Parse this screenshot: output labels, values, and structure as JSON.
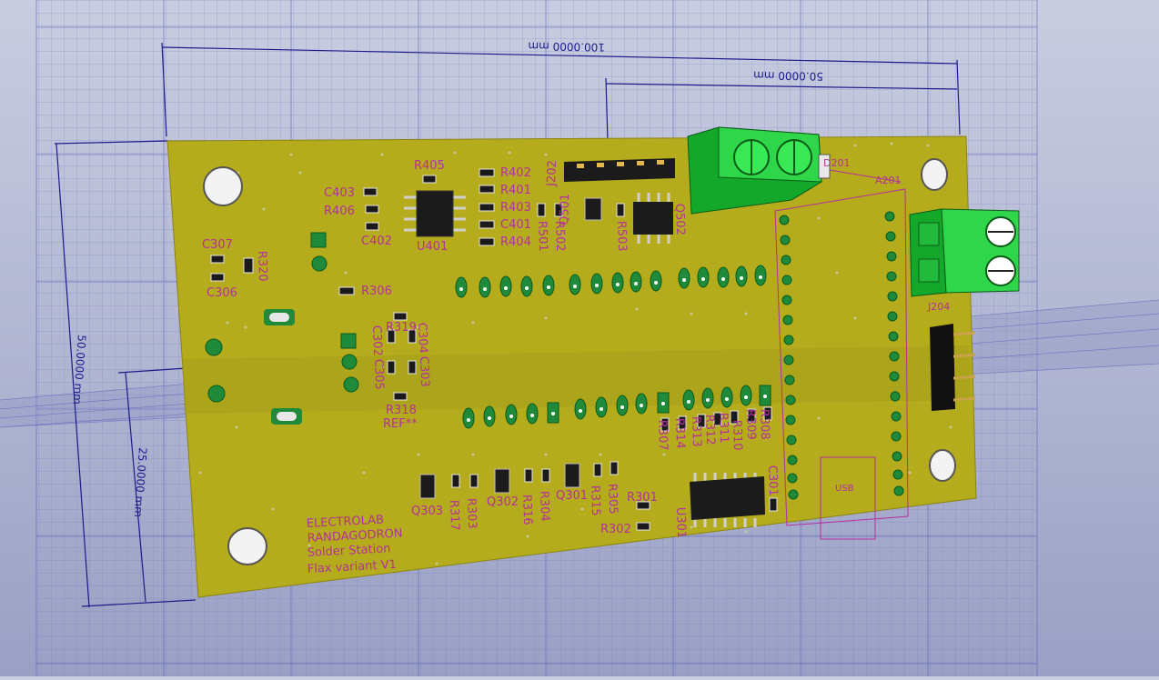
{
  "viewer": {
    "dimensions": {
      "width_total": "100.0000 mm",
      "width_half": "50.0000 mm",
      "height_total": "50.0000 mm",
      "height_half": "25.0000 mm"
    }
  },
  "board": {
    "colors": {
      "substrate": "#b5ac1d",
      "silkscreen": "#b4309a",
      "dimension": "#1a1a8a",
      "terminal": "#2fd64a"
    },
    "title_lines": [
      "ELECTROLAB",
      "RANDAGODRON",
      "Solder Station",
      "Flax variant V1"
    ],
    "refs": {
      "R405": "R405",
      "R402": "R402",
      "R401": "R401",
      "R403": "R403",
      "C401": "C401",
      "R404": "R404",
      "C403": "C403",
      "R406": "R406",
      "C402": "C402",
      "U401": "U401",
      "J202": "J202",
      "Q501": "Q501",
      "R501": "R501",
      "R502": "R502",
      "R503": "R503",
      "Q502": "Q502",
      "D201": "D201",
      "A201": "A201",
      "J204": "J204",
      "C307": "C307",
      "R320": "R320",
      "C306": "C306",
      "R306": "R306",
      "R319": "R319",
      "C304": "C304",
      "C302": "C302",
      "C305": "C305",
      "C303": "C303",
      "R318": "R318",
      "REF": "REF**",
      "R307": "R307",
      "R314": "R314",
      "R313": "R313",
      "R312": "R312",
      "R311": "R311",
      "R310": "R310",
      "R309": "R309",
      "R308": "R308",
      "C301": "C301",
      "Q303": "Q303",
      "R317": "R317",
      "R303": "R303",
      "Q302": "Q302",
      "R316": "R316",
      "R304": "R304",
      "Q301": "Q301",
      "R315": "R315",
      "R305": "R305",
      "R301": "R301",
      "R302": "R302",
      "U301": "U301",
      "USB": "USB"
    }
  }
}
